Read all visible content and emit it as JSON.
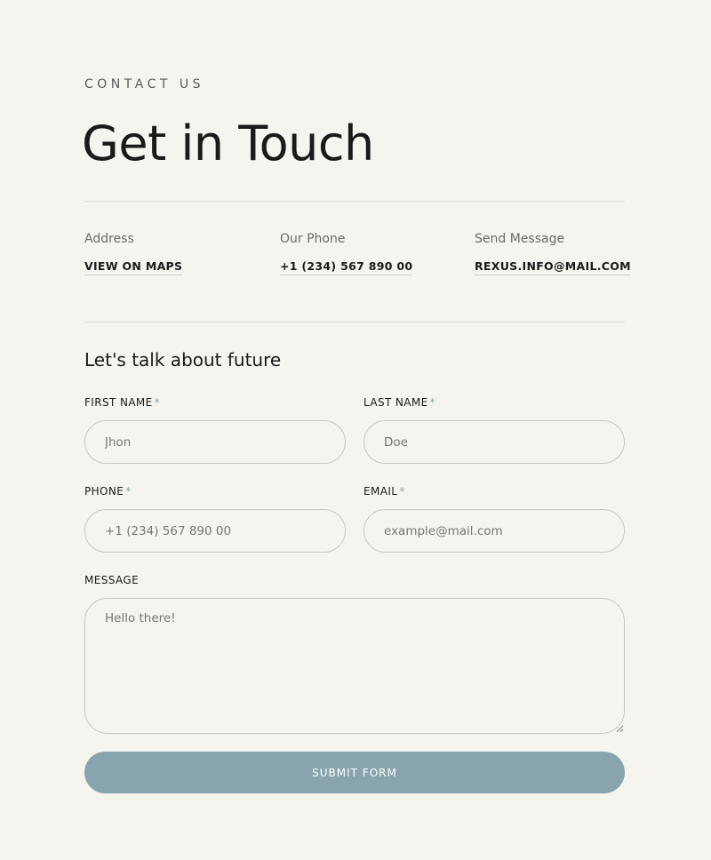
{
  "header": {
    "eyebrow": "CONTACT US",
    "title": "Get in Touch"
  },
  "info": [
    {
      "label": "Address",
      "link": "VIEW ON MAPS"
    },
    {
      "label": "Our Phone",
      "link": "+1 (234) 567 890 00"
    },
    {
      "label": "Send Message",
      "link": "REXUS.INFO@MAIL.COM"
    }
  ],
  "form": {
    "title": "Let's talk about future",
    "required_mark": "*",
    "first_name": {
      "label": "FIRST NAME",
      "placeholder": "Jhon"
    },
    "last_name": {
      "label": "LAST NAME",
      "placeholder": "Doe"
    },
    "phone": {
      "label": "PHONE",
      "placeholder": "+1 (234) 567 890 00"
    },
    "email": {
      "label": "EMAIL",
      "placeholder": "example@mail.com"
    },
    "message": {
      "label": "MESSAGE",
      "placeholder": "Hello there!"
    },
    "submit_label": "SUBMIT FORM"
  },
  "colors": {
    "background": "#f6f4ef",
    "accent": "#88a4ae",
    "text": "#1a1a1a",
    "border": "#c9c6c0"
  }
}
